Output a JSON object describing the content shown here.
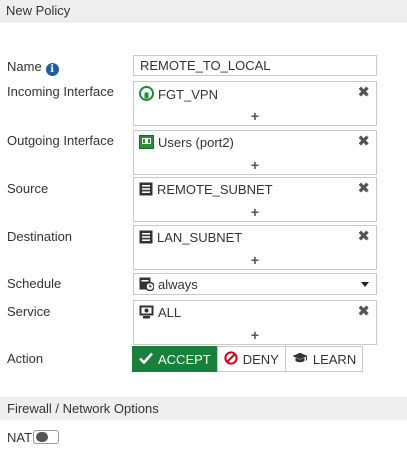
{
  "header": {
    "title": "New Policy"
  },
  "form": {
    "name": {
      "label": "Name",
      "value": "REMOTE_TO_LOCAL"
    },
    "incoming": {
      "label": "Incoming Interface",
      "value": "FGT_VPN",
      "icon": "vpn-tunnel-icon"
    },
    "outgoing": {
      "label": "Outgoing Interface",
      "value": "Users (port2)",
      "icon": "network-port-icon"
    },
    "source": {
      "label": "Source",
      "value": "REMOTE_SUBNET",
      "icon": "address-object-icon"
    },
    "destination": {
      "label": "Destination",
      "value": "LAN_SUBNET",
      "icon": "address-object-icon"
    },
    "schedule": {
      "label": "Schedule",
      "value": "always",
      "icon": "schedule-icon"
    },
    "service": {
      "label": "Service",
      "value": "ALL",
      "icon": "service-icon"
    },
    "action": {
      "label": "Action",
      "options": [
        "ACCEPT",
        "DENY",
        "LEARN"
      ],
      "selected": "ACCEPT"
    },
    "add_symbol": "+",
    "remove_symbol": "✖"
  },
  "firewall_section": {
    "title": "Firewall / Network Options"
  },
  "nat": {
    "label": "NAT",
    "enabled": false
  },
  "colors": {
    "accept_green": "#19803b",
    "deny_red": "#d0021b",
    "info_blue": "#1f5f9e"
  }
}
